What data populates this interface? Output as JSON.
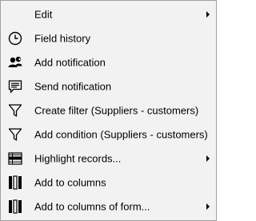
{
  "menu": {
    "items": [
      {
        "label": "Edit",
        "icon": "none",
        "submenu": true
      },
      {
        "label": "Field history",
        "icon": "clock-icon",
        "submenu": false
      },
      {
        "label": "Add notification",
        "icon": "users-notification-icon",
        "submenu": false
      },
      {
        "label": "Send notification",
        "icon": "chat-message-icon",
        "submenu": false
      },
      {
        "label": "Create filter (Suppliers - customers)",
        "icon": "filter-icon",
        "submenu": false
      },
      {
        "label": "Add condition (Suppliers - customers)",
        "icon": "filter-icon",
        "submenu": false
      },
      {
        "label": "Highlight records...",
        "icon": "table-highlight-icon",
        "submenu": true
      },
      {
        "label": "Add to columns",
        "icon": "columns-icon",
        "submenu": false
      },
      {
        "label": "Add to columns of form...",
        "icon": "columns-icon",
        "submenu": true
      }
    ]
  }
}
